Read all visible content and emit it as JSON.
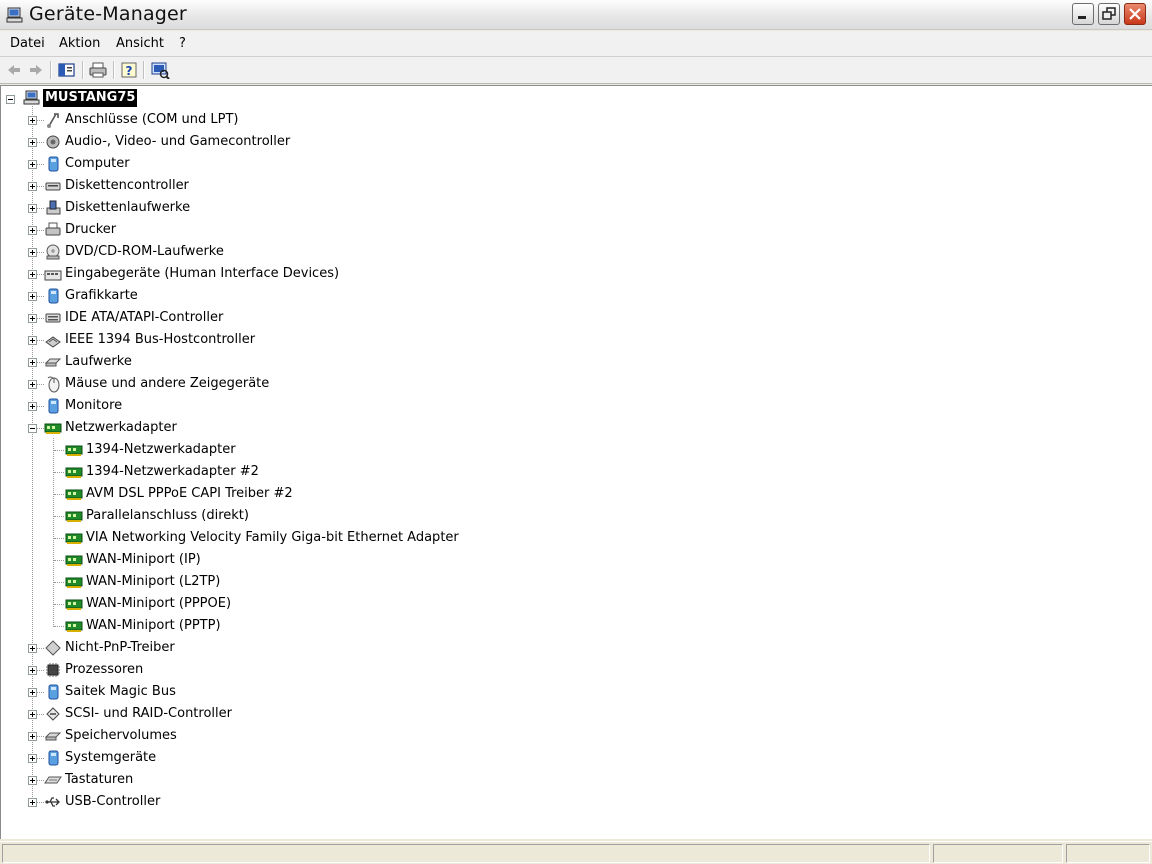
{
  "window": {
    "title": "Geräte-Manager"
  },
  "menu": {
    "items": [
      {
        "label": "Datei"
      },
      {
        "label": "Aktion"
      },
      {
        "label": "Ansicht"
      },
      {
        "label": "?"
      }
    ]
  },
  "toolbar": {
    "buttons": [
      "back-icon",
      "forward-icon",
      "properties-icon",
      "print-icon",
      "help-icon",
      "scan-hardware-icon"
    ]
  },
  "tree": {
    "root": {
      "label": "MUSTANG75",
      "icon": "computer-icon"
    },
    "categories": [
      {
        "label": "Anschlüsse (COM und LPT)",
        "icon": "port-icon"
      },
      {
        "label": "Audio-, Video- und Gamecontroller",
        "icon": "audio-icon"
      },
      {
        "label": "Computer",
        "icon": "computer-device-icon"
      },
      {
        "label": "Diskettencontroller",
        "icon": "floppy-controller-icon"
      },
      {
        "label": "Diskettenlaufwerke",
        "icon": "floppy-drive-icon"
      },
      {
        "label": "Drucker",
        "icon": "printer-icon"
      },
      {
        "label": "DVD/CD-ROM-Laufwerke",
        "icon": "cdrom-icon"
      },
      {
        "label": "Eingabegeräte (Human Interface Devices)",
        "icon": "hid-icon"
      },
      {
        "label": "Grafikkarte",
        "icon": "display-adapter-icon"
      },
      {
        "label": "IDE ATA/ATAPI-Controller",
        "icon": "ide-icon"
      },
      {
        "label": "IEEE 1394 Bus-Hostcontroller",
        "icon": "ieee1394-icon"
      },
      {
        "label": "Laufwerke",
        "icon": "disk-drive-icon"
      },
      {
        "label": "Mäuse und andere Zeigegeräte",
        "icon": "mouse-icon"
      },
      {
        "label": "Monitore",
        "icon": "monitor-icon"
      },
      {
        "label": "Netzwerkadapter",
        "icon": "network-adapter-icon",
        "expanded": true,
        "children": [
          {
            "label": "1394-Netzwerkadapter"
          },
          {
            "label": "1394-Netzwerkadapter #2"
          },
          {
            "label": "AVM DSL PPPoE CAPI Treiber #2"
          },
          {
            "label": "Parallelanschluss (direkt)"
          },
          {
            "label": "VIA Networking Velocity Family Giga-bit Ethernet Adapter"
          },
          {
            "label": "WAN-Miniport (IP)"
          },
          {
            "label": "WAN-Miniport (L2TP)"
          },
          {
            "label": "WAN-Miniport (PPPOE)"
          },
          {
            "label": "WAN-Miniport (PPTP)"
          }
        ]
      },
      {
        "label": "Nicht-PnP-Treiber",
        "icon": "non-pnp-icon"
      },
      {
        "label": "Prozessoren",
        "icon": "processor-icon"
      },
      {
        "label": "Saitek Magic Bus",
        "icon": "bus-icon"
      },
      {
        "label": "SCSI- und RAID-Controller",
        "icon": "scsi-icon"
      },
      {
        "label": "Speichervolumes",
        "icon": "volume-icon"
      },
      {
        "label": "Systemgeräte",
        "icon": "system-device-icon"
      },
      {
        "label": "Tastaturen",
        "icon": "keyboard-icon"
      },
      {
        "label": "USB-Controller",
        "icon": "usb-icon"
      }
    ]
  }
}
